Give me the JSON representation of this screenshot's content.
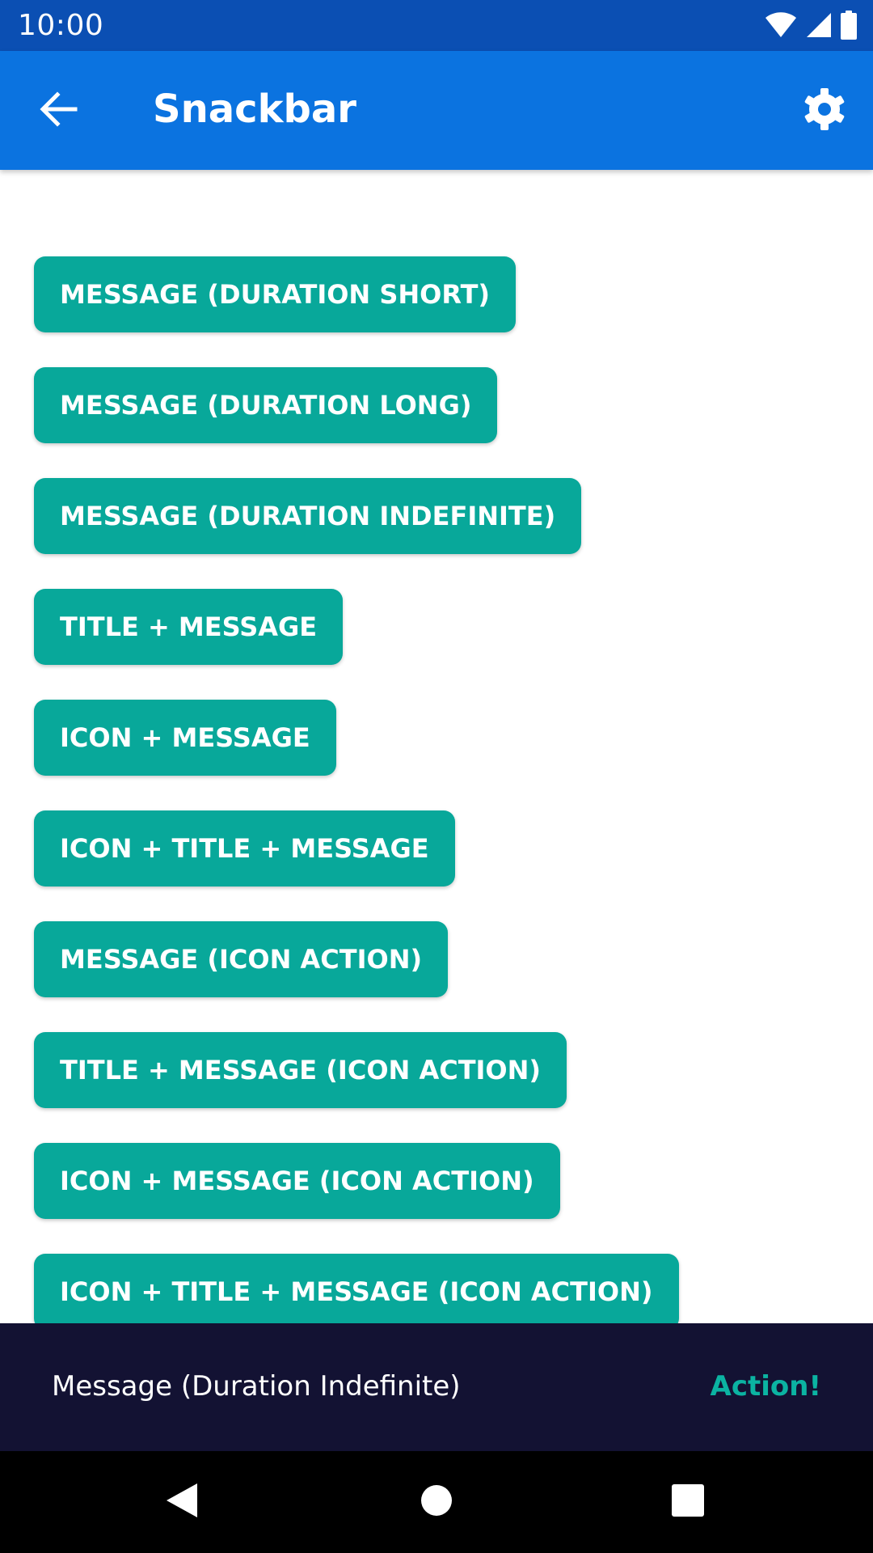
{
  "status_bar": {
    "time": "10:00",
    "icons": [
      "wifi-icon",
      "cell-signal-icon",
      "battery-icon"
    ]
  },
  "app_bar": {
    "title": "Snackbar",
    "back_icon": "arrow-left-icon",
    "settings_icon": "gear-icon"
  },
  "buttons": [
    "MESSAGE (DURATION SHORT)",
    "MESSAGE (DURATION LONG)",
    "MESSAGE (DURATION INDEFINITE)",
    "TITLE + MESSAGE",
    "ICON + MESSAGE",
    "ICON + TITLE + MESSAGE",
    "MESSAGE (ICON ACTION)",
    "TITLE + MESSAGE (ICON ACTION)",
    "ICON + MESSAGE (ICON ACTION)",
    "ICON + TITLE + MESSAGE (ICON ACTION)"
  ],
  "snackbar": {
    "message": "Message (Duration Indefinite)",
    "action": "Action!"
  },
  "nav_bar": {
    "icons": [
      "nav-back-icon",
      "nav-home-icon",
      "nav-recents-icon"
    ]
  },
  "colors": {
    "status_bar": "#0b4fb3",
    "app_bar": "#0b73e0",
    "button": "#08a89a",
    "snackbar_bg": "#131233",
    "snackbar_action": "#0bb3a2"
  }
}
